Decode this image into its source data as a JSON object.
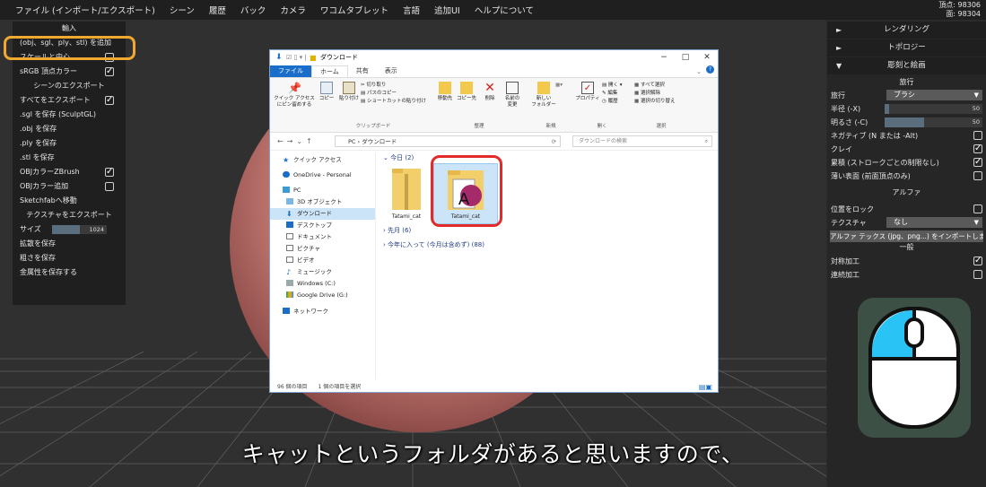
{
  "menubar": {
    "items": [
      "ファイル (インポート/エクスポート)",
      "シーン",
      "履歴",
      "バック",
      "カメラ",
      "ワコムタブレット",
      "言語",
      "追加UI",
      "ヘルプについて"
    ],
    "stats": [
      "頂点: 98306",
      "面: 98304"
    ]
  },
  "left_panel": {
    "import_title": "輸入",
    "import_add": "(obj、sgl、ply、stl) を追加",
    "scale_center": "スケールと中心",
    "srgb": "sRGB 頂点カラー",
    "scene_export_title": "シーンのエクスポート",
    "export_all": "すべてをエクスポート",
    "save_sgl": ".sgl を保存 (SculptGL)",
    "save_obj": ".obj を保存",
    "save_ply": ".ply を保存",
    "save_stl": ".stl を保存",
    "obj_zbrush": "OBJカラーZBrush",
    "obj_color_add": "OBJカラー追加",
    "sketchfab": "Sketchfabへ移動",
    "texture_export_title": "テクスチャをエクスポート",
    "size_label": "サイズ",
    "size_value": "1024",
    "size_fraction": 0.5,
    "save_diffuse": "拡散を保存",
    "save_roughness": "粗さを保存",
    "save_metal": "金属性を保存する"
  },
  "right_panel": {
    "rendering": "レンダリング",
    "topology": "トポロジー",
    "sculpt_paint": "彫刻と絵画",
    "tool_section": "旅行",
    "tool_label": "旅行",
    "tool_value": "ブラシ",
    "radius_label": "半径 (-X)",
    "radius_value": "50",
    "radius_fraction": 0.05,
    "intensity_label": "明るさ (-C)",
    "intensity_value": "50",
    "intensity_fraction": 0.4,
    "negative": "ネガティブ (N または -Alt)",
    "clay": "クレイ",
    "accumulate": "累積 (ストロークごとの制限なし)",
    "thin_surface": "薄い表面 (前面頂点のみ)",
    "alpha_section": "アルファ",
    "lock_position": "位置をロック",
    "texture_label": "テクスチャ",
    "texture_value": "なし",
    "alpha_import": "アルファ テックス (jpg、png...) をインポートします",
    "general_section": "一般",
    "symmetry": "対称加工",
    "continuous": "連続加工"
  },
  "explorer": {
    "title": "ダウンロード",
    "tabs": [
      "ファイル",
      "ホーム",
      "共有",
      "表示"
    ],
    "ribbon": {
      "pin_quick": "クイック アクセス\nにピン留めする",
      "copy": "コピー",
      "paste": "貼り付け",
      "cut": "切り取り",
      "copy_path": "パスのコピー",
      "paste_shortcut": "ショートカットの貼り付け",
      "group_clipboard": "クリップボード",
      "move_to": "移動先",
      "copy_to": "コピー先",
      "delete": "削除",
      "rename": "名前の\n変更",
      "group_organize": "整理",
      "new_folder": "新しい\nフォルダー",
      "group_new": "新規",
      "properties": "プロパティ",
      "open": "開く",
      "edit": "編集",
      "history": "履歴",
      "group_open": "開く",
      "select_all": "すべて選択",
      "select_none": "選択解除",
      "invert_selection": "選択の切り替え",
      "group_select": "選択"
    },
    "address": [
      "PC",
      "ダウンロード"
    ],
    "search_placeholder": "ダウンロードの検索",
    "nav": [
      "クイック アクセス",
      "OneDrive - Personal",
      "PC",
      "3D オブジェクト",
      "ダウンロード",
      "デスクトップ",
      "ドキュメント",
      "ピクチャ",
      "ビデオ",
      "ミュージック",
      "Windows (C:)",
      "Google Drive (G:)",
      "ネットワーク"
    ],
    "group_today": "今日 (2)",
    "group_last_month": "先月 (6)",
    "group_this_year": "今年に入って (今月は含めず) (88)",
    "file1": "Tatami_cat",
    "file2": "Tatami_cat",
    "status_count": "96 個の項目",
    "status_selected": "1 個の項目を選択"
  },
  "subtitle": "キャットというフォルダがあると思いますので、",
  "colors": {
    "highlight": "#f0a92f",
    "select_ring": "#e22a2a",
    "mouse_tile": "#3d5046",
    "mouse_left": "#29c3f5"
  }
}
